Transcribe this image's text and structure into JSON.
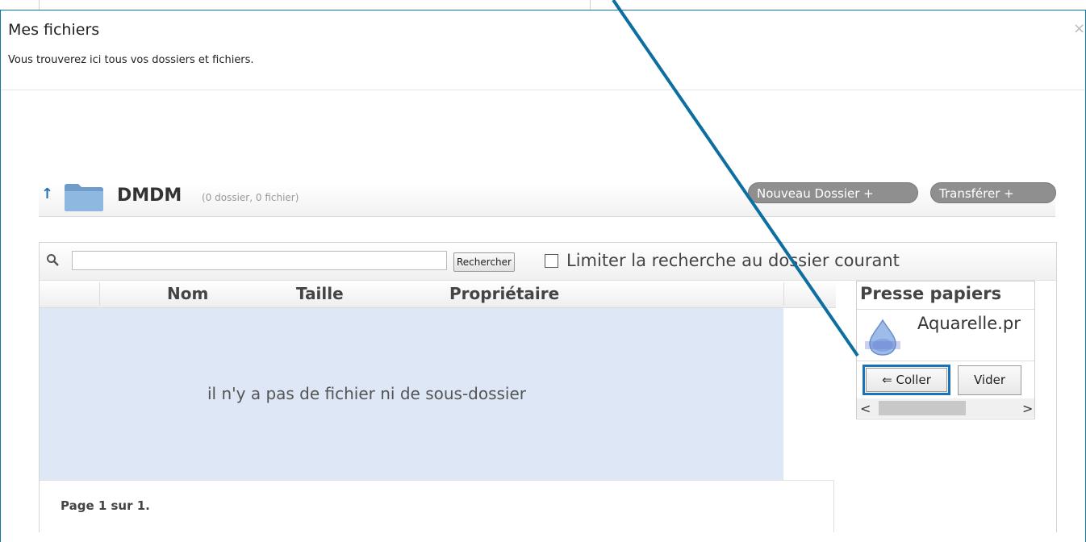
{
  "modal": {
    "title": "Mes fichiers",
    "subtitle": "Vous trouverez ici tous vos dossiers et fichiers.",
    "close_glyph": "×"
  },
  "folder": {
    "up_glyph": "↑",
    "name": "DMDM",
    "count": "(0 dossier, 0 fichier)"
  },
  "actions": {
    "new_folder": "Nouveau Dossier +",
    "upload": "Transférer +"
  },
  "search": {
    "input_value": "",
    "button": "Rechercher",
    "limit_label": "Limiter la recherche au dossier courant",
    "limit_checked": false
  },
  "table": {
    "columns": [
      "Nom",
      "Taille",
      "Propriétaire"
    ],
    "empty_message": "il n'y a pas de fichier ni de sous-dossier",
    "pager": "Page 1 sur 1."
  },
  "clipboard": {
    "title": "Presse papiers",
    "file_name": "Aquarelle.pr",
    "paste_button": "⇐ Coller",
    "clear_button": "Vider",
    "scroll_left": "<",
    "scroll_right": ">"
  },
  "colors": {
    "accent": "#0d77a3",
    "highlight_box": "#1a73b8",
    "empty_bg": "#dde7f5",
    "pill_bg": "#8f8f8f"
  },
  "icons": {
    "folder": "folder-icon",
    "search": "search-icon",
    "thumbnail": "image-thumbnail-icon"
  }
}
